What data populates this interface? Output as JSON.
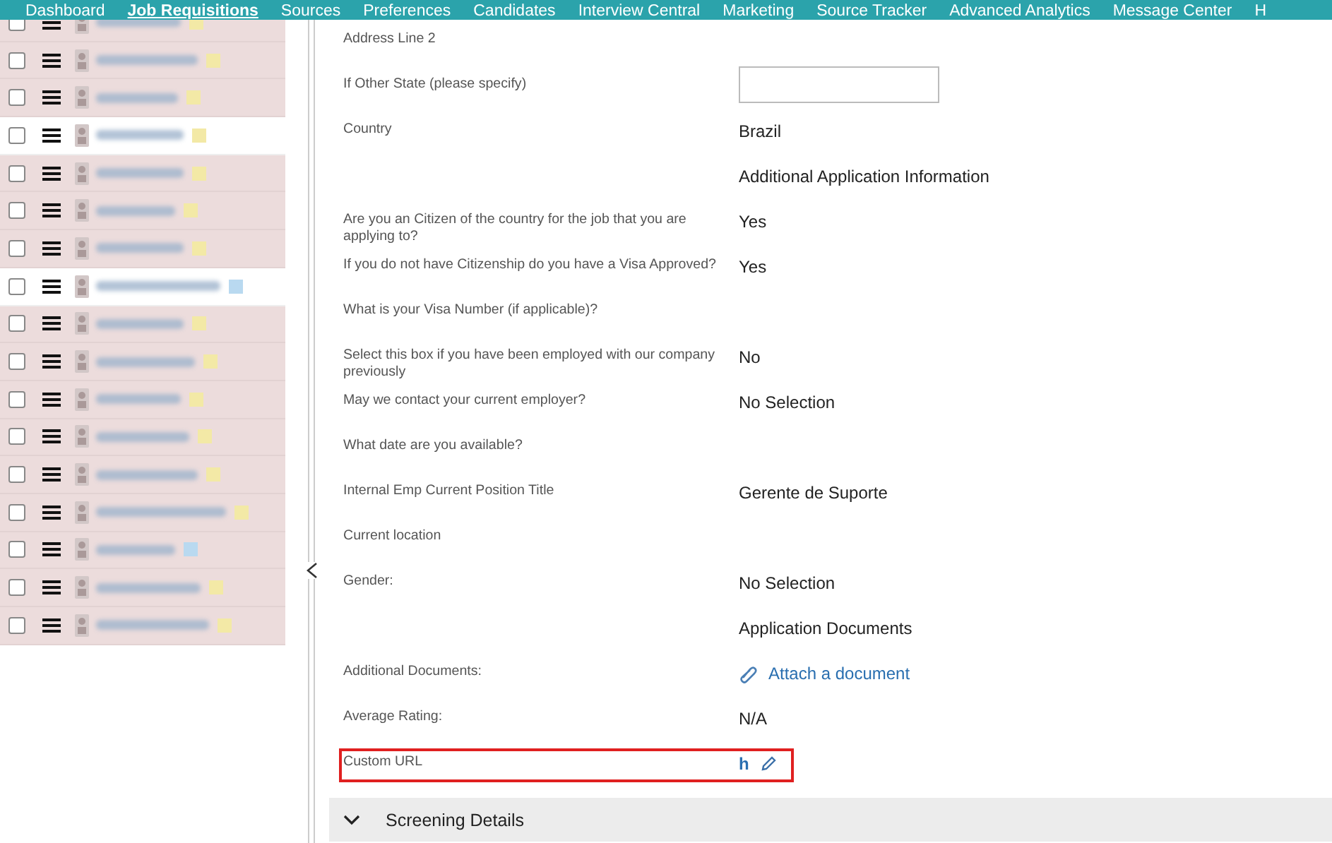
{
  "nav": {
    "items": [
      {
        "label": "Dashboard",
        "selected": false
      },
      {
        "label": "Job Requisitions",
        "selected": true
      },
      {
        "label": "Sources",
        "selected": false
      },
      {
        "label": "Preferences",
        "selected": false
      },
      {
        "label": "Candidates",
        "selected": false
      },
      {
        "label": "Interview Central",
        "selected": false
      },
      {
        "label": "Marketing",
        "selected": false
      },
      {
        "label": "Source Tracker",
        "selected": false
      },
      {
        "label": "Advanced Analytics",
        "selected": false
      },
      {
        "label": "Message Center",
        "selected": false
      },
      {
        "label": "H",
        "selected": false
      }
    ]
  },
  "candidates": [
    {
      "highlighted": true,
      "color": "#f3e9a6"
    },
    {
      "highlighted": true,
      "checked": false,
      "color": "#f3e9a6"
    },
    {
      "highlighted": true,
      "checked": false,
      "color": "#f3e9a6"
    },
    {
      "highlighted": false,
      "checked": false,
      "color": "#f3e9a6"
    },
    {
      "highlighted": true,
      "checked": false,
      "color": "#f3e9a6"
    },
    {
      "highlighted": true,
      "checked": false,
      "color": "#f3e9a6"
    },
    {
      "highlighted": true,
      "checked": false,
      "color": "#f3e9a6"
    },
    {
      "highlighted": false,
      "checked": false,
      "color": "#b9d9f0"
    },
    {
      "highlighted": true,
      "checked": false,
      "color": "#f3e9a6"
    },
    {
      "highlighted": true,
      "checked": false,
      "color": "#f3e9a6"
    },
    {
      "highlighted": true,
      "checked": false,
      "color": "#f3e9a6"
    },
    {
      "highlighted": true,
      "checked": false,
      "color": "#f3e9a6"
    },
    {
      "highlighted": true,
      "checked": false,
      "color": "#f3e9a6"
    },
    {
      "highlighted": true,
      "checked": false,
      "color": "#f3e9a6"
    },
    {
      "highlighted": true,
      "checked": false,
      "color": "#b9d9f0"
    },
    {
      "highlighted": true,
      "checked": false,
      "color": "#f3e9a6"
    },
    {
      "highlighted": true,
      "checked": false,
      "color": "#f3e9a6"
    }
  ],
  "fields": [
    {
      "kind": "text",
      "label": "Address Line 2"
    },
    {
      "kind": "input",
      "label": "If Other State (please specify)"
    },
    {
      "kind": "text",
      "label": "Country",
      "value": "Brazil"
    },
    {
      "kind": "section",
      "value": "Additional Application Information"
    },
    {
      "kind": "text",
      "label": "Are you an Citizen of the country for the job that you are applying to?",
      "value": "Yes"
    },
    {
      "kind": "text",
      "label": "If you do not have Citizenship do you have a Visa Approved?",
      "value": "Yes"
    },
    {
      "kind": "text",
      "label": "What is your Visa Number (if applicable)?"
    },
    {
      "kind": "text",
      "label": "Select this box if you have been employed with our company previously",
      "value": "No"
    },
    {
      "kind": "text",
      "label": "May we contact your current employer?",
      "value": "No Selection"
    },
    {
      "kind": "text",
      "label": "What date are you available?"
    },
    {
      "kind": "text",
      "label": "Internal Emp Current Position Title",
      "value": "Gerente de Suporte"
    },
    {
      "kind": "text",
      "label": "Current location"
    },
    {
      "kind": "text",
      "label": "Gender:",
      "value": "No Selection"
    },
    {
      "kind": "section",
      "value": "Application Documents"
    },
    {
      "kind": "attach",
      "label": "Additional Documents:",
      "value": "Attach a document"
    },
    {
      "kind": "text",
      "label": "Average Rating:",
      "value": "N/A"
    },
    {
      "kind": "edit",
      "label": "Custom URL",
      "value": "h",
      "outlined": true
    }
  ],
  "screening": {
    "title": "Screening Details",
    "expanded": true
  }
}
